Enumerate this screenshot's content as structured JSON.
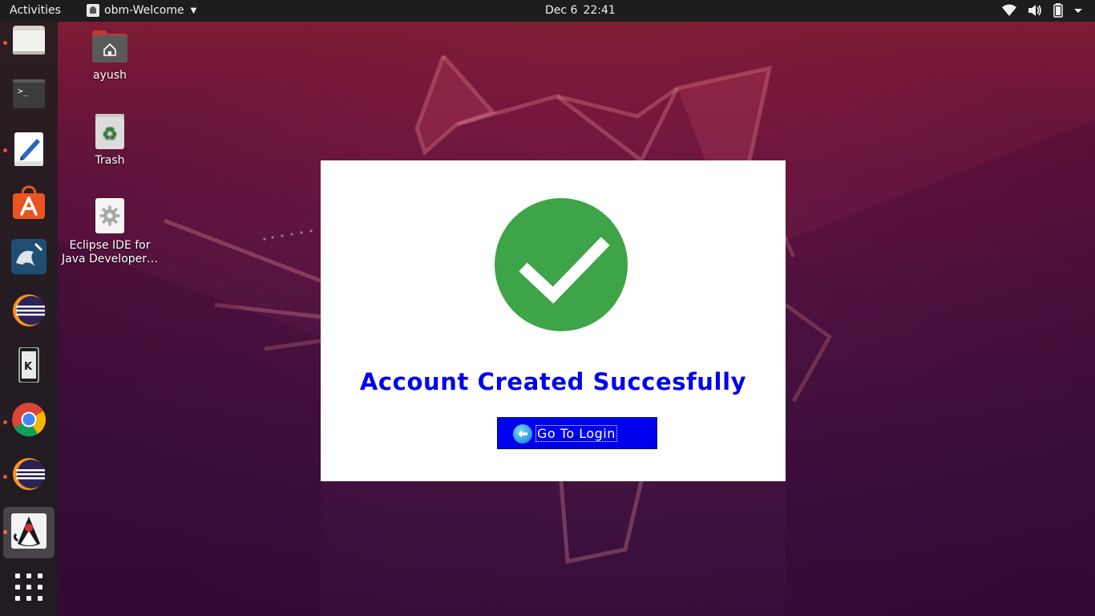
{
  "topbar": {
    "activities": "Activities",
    "app_name": "obm-Welcome",
    "date": "Dec 6",
    "time": "22:41"
  },
  "tray_icons": [
    "wifi-icon",
    "volume-icon",
    "battery-icon",
    "power-menu-caret-icon"
  ],
  "dock": {
    "items": [
      {
        "name": "files",
        "running": true
      },
      {
        "name": "terminal",
        "running": false
      },
      {
        "name": "text-editor",
        "running": true
      },
      {
        "name": "software-store",
        "running": false
      },
      {
        "name": "mysql-workbench",
        "running": false
      },
      {
        "name": "eclipse",
        "running": false
      },
      {
        "name": "kde-connect",
        "running": false
      },
      {
        "name": "chrome",
        "running": true
      },
      {
        "name": "eclipse-2",
        "running": true
      },
      {
        "name": "java-duke",
        "running": true,
        "active": true
      },
      {
        "name": "show-applications",
        "running": false
      }
    ]
  },
  "desktop": {
    "icons": [
      {
        "label": "ayush",
        "icon": "home-folder-icon"
      },
      {
        "label": "Trash",
        "icon": "trash-icon"
      },
      {
        "label_line1": "Eclipse IDE for",
        "label_line2": "Java Developer…",
        "icon": "eclipse-launcher-icon"
      }
    ]
  },
  "dialog": {
    "message": "Account Created Succesfully",
    "button_label": "Go To Login",
    "colors": {
      "check": "#3da447",
      "title": "#0000ee",
      "button": "#0000f0"
    }
  }
}
